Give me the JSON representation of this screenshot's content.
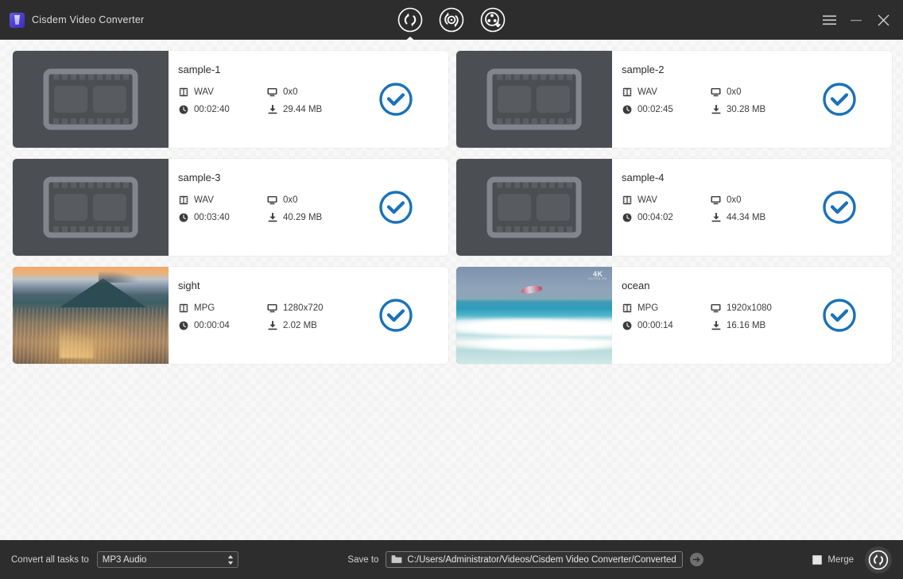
{
  "window": {
    "title": "Cisdem Video Converter",
    "logo_icon": "cisdem-logo-icon",
    "menu_icon": "hamburger-menu-icon",
    "minimize_icon": "minimize-icon",
    "close_icon": "close-icon"
  },
  "toolbar": {
    "tabs": [
      {
        "name": "video-converter",
        "icon": "convert-arrows-icon",
        "active": true
      },
      {
        "name": "audio-converter",
        "icon": "disc-convert-icon",
        "active": false
      },
      {
        "name": "video-downloader",
        "icon": "film-reel-download-icon",
        "active": false
      }
    ]
  },
  "files": [
    {
      "name": "sample-1",
      "format": "WAV",
      "resolution": "0x0",
      "duration": "00:02:40",
      "size": "29.44 MB",
      "thumbnail": "film-placeholder",
      "selected": true
    },
    {
      "name": "sample-2",
      "format": "WAV",
      "resolution": "0x0",
      "duration": "00:02:45",
      "size": "30.28 MB",
      "thumbnail": "film-placeholder",
      "selected": true
    },
    {
      "name": "sample-3",
      "format": "WAV",
      "resolution": "0x0",
      "duration": "00:03:40",
      "size": "40.29 MB",
      "thumbnail": "film-placeholder",
      "selected": true
    },
    {
      "name": "sample-4",
      "format": "WAV",
      "resolution": "0x0",
      "duration": "00:04:02",
      "size": "44.34 MB",
      "thumbnail": "film-placeholder",
      "selected": true
    },
    {
      "name": "sight",
      "format": "MPG",
      "resolution": "1280x720",
      "duration": "00:00:04",
      "size": "2.02 MB",
      "thumbnail": "city-sunset-photo",
      "selected": true
    },
    {
      "name": "ocean",
      "format": "MPG",
      "resolution": "1920x1080",
      "duration": "00:00:14",
      "size": "16.16 MB",
      "thumbnail": "ocean-beach-photo",
      "badge": "4K",
      "badge_sub": "ULTRA HD",
      "selected": true
    }
  ],
  "meta_icons": {
    "format": "film-strip-icon",
    "resolution": "monitor-icon",
    "duration": "clock-icon",
    "size": "download-size-icon",
    "selected": "check-circle-icon"
  },
  "bottom": {
    "convert_label": "Convert all tasks to",
    "profile_value": "MP3 Audio",
    "save_to_label": "Save to",
    "output_path": "C:/Users/Administrator/Videos/Cisdem Video Converter/Converted",
    "folder_icon": "folder-icon",
    "open_folder_icon": "arrow-right-icon",
    "merge_label": "Merge",
    "merge_checked": false,
    "convert_button_icon": "convert-arrows-icon"
  },
  "colors": {
    "accent_blue": "#1a72b8",
    "titlebar_bg": "#2d2d2d",
    "content_bg": "#f8f8f8",
    "card_bg": "#ffffff",
    "placeholder_bg": "#4b4e53"
  }
}
